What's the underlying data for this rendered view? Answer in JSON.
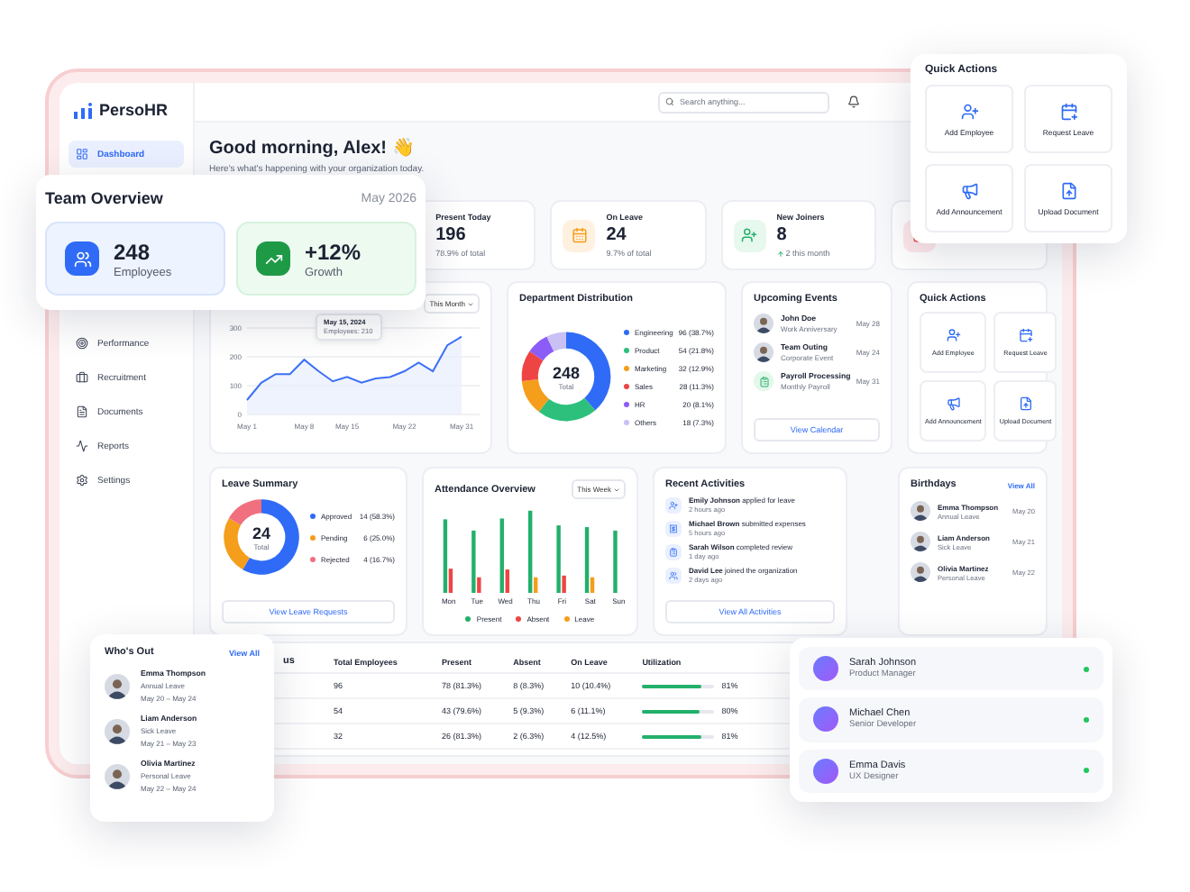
{
  "sidebar": {
    "logo": "PersoHR",
    "items": [
      {
        "label": "Dashboard",
        "selected": true
      },
      {
        "label": "Performance",
        "selected": false
      },
      {
        "label": "Recruitment",
        "selected": false
      },
      {
        "label": "Documents",
        "selected": false
      },
      {
        "label": "Reports",
        "selected": false
      },
      {
        "label": "Settings",
        "selected": false
      }
    ]
  },
  "header": {
    "search": {
      "placeholder": "Search anything..."
    }
  },
  "greeting": {
    "title": "Good morning, Alex! 👋",
    "subtitle": "Here's what's happening with your organization today."
  },
  "stats": [
    {
      "kind": "stat",
      "label": "Present Today",
      "value": "196",
      "note": "78.9% of total",
      "rising": false
    },
    {
      "kind": "stat",
      "label": "On Leave",
      "value": "24",
      "note": "9.7% of total",
      "rising": false
    },
    {
      "kind": "stat",
      "label": "New Joiners",
      "value": "8",
      "note": "2 this month",
      "rising": true
    },
    {
      "kind": "icon_only"
    }
  ],
  "growth": {
    "range": "This Month",
    "tooltip": {
      "date": "May 15, 2024",
      "text": "Employees: 210"
    },
    "chart_data": {
      "type": "area",
      "categories": [
        "May 1",
        null,
        null,
        null,
        "May 8",
        null,
        null,
        "May 15",
        null,
        null,
        null,
        "May 22",
        null,
        null,
        null,
        "May 31"
      ],
      "series": [
        {
          "color": "#3b6ff5",
          "values": [
            50,
            110,
            140,
            140,
            190,
            150,
            115,
            130,
            110,
            125,
            130,
            150,
            180,
            150,
            240,
            270
          ]
        }
      ],
      "ylim": [
        0,
        300
      ],
      "yticks": [
        0,
        100,
        200,
        300
      ]
    }
  },
  "department": {
    "title": "Department Distribution",
    "total": "248",
    "total_label": "Total",
    "legend": [
      {
        "value": "96 (38.7%)",
        "color": "#2f6bf6"
      },
      {
        "value": "54 (21.8%)",
        "color": "#2cc07c"
      },
      {
        "value": "32 (12.9%)",
        "color": "#f59e1b"
      },
      {
        "value": "28 (11.3%)",
        "color": "#ef4444"
      },
      {
        "value": "20 (8.1%)",
        "color": "#8b5cf6"
      },
      {
        "value": "18 (7.3%)",
        "color": "#c9c0f4"
      }
    ],
    "chart_data": {
      "type": "donut",
      "categories": [
        "Engineering",
        "Product",
        "Marketing",
        "Sales",
        "HR",
        "Others"
      ],
      "values": [
        38.7,
        21.8,
        12.9,
        11.3,
        8.1,
        7.2
      ]
    }
  },
  "events": {
    "title": "Upcoming Events",
    "items": [
      {
        "kind": "person",
        "title": "John Doe",
        "subtitle": "Work Anniversary",
        "date": "May 28"
      },
      {
        "kind": "person",
        "title": "Team Outing",
        "subtitle": "Corporate Event",
        "date": "May 24"
      },
      {
        "kind": "task",
        "title": "Payroll Processing",
        "subtitle": "Monthly Payroll",
        "date": "May 31"
      }
    ],
    "button": "View Calendar"
  },
  "quick_actions": {
    "title": "Quick Actions",
    "items": [
      "Add Employee",
      "Request Leave",
      "Add Announcement",
      "Upload Document"
    ]
  },
  "leave": {
    "title": "Leave Summary",
    "total": "24",
    "total_label": "Total",
    "legend": [
      {
        "value": "14 (58.3%)",
        "color": "#2f6bf6"
      },
      {
        "value": "6 (25.0%)",
        "color": "#f59e1b"
      },
      {
        "value": "4 (16.7%)",
        "color": "#f0707f"
      }
    ],
    "chart_data": {
      "type": "donut",
      "categories": [
        "Approved",
        "Pending",
        "Rejected"
      ],
      "values": [
        58.3,
        25.0,
        16.7
      ]
    },
    "button": "View Leave Requests"
  },
  "attendance": {
    "title": "Attendance Overview",
    "range": "This Week",
    "days": [
      "Mon",
      "Tue",
      "Wed",
      "Thu",
      "Fri",
      "Sat",
      "Sun"
    ],
    "legend": [
      {
        "label": "Present",
        "color": "#22b06b"
      },
      {
        "label": "Absent",
        "color": "#ef4444"
      },
      {
        "label": "Leave",
        "color": "#f59e1b"
      }
    ]
  },
  "activities": {
    "title": "Recent Activities",
    "items": [
      {
        "text": "**Emily Johnson** applied for leave",
        "time": "2 hours ago"
      },
      {
        "text": "**Michael Brown** submitted expenses",
        "time": "5 hours ago"
      },
      {
        "text": "**Sarah Wilson** completed review",
        "time": "1 day ago"
      },
      {
        "text": "**David Lee** joined the organization",
        "time": "2 days ago"
      }
    ],
    "button": "View All Activities"
  },
  "birthdays": {
    "title": "Birthdays",
    "link": "View All",
    "items": [
      {
        "name": "Emma Thompson",
        "note": "Annual Leave",
        "date": "May 20"
      },
      {
        "name": "Liam Anderson",
        "note": "Sick Leave",
        "date": "May 21"
      },
      {
        "name": "Olivia Martinez",
        "note": "Personal Leave",
        "date": "May 22"
      }
    ]
  },
  "table": {
    "title_fragment": "us",
    "columns": [
      "Total Employees",
      "Present",
      "Absent",
      "On Leave",
      "Utilization"
    ],
    "rows": [
      {
        "cells": [
          "96",
          "78 (81.3%)",
          "8 (8.3%)",
          "10 (10.4%)"
        ],
        "level": 0.81,
        "reading": "81%"
      },
      {
        "cells": [
          "54",
          "43 (79.6%)",
          "5 (9.3%)",
          "6 (11.1%)"
        ],
        "level": 0.8,
        "reading": "80%"
      },
      {
        "cells": [
          "32",
          "26 (81.3%)",
          "2 (6.3%)",
          "4 (12.5%)"
        ],
        "level": 0.81,
        "reading": "81%"
      }
    ]
  },
  "team_overview": {
    "title": "Team Overview",
    "period": "May 2026",
    "tiles": [
      {
        "kind": "people",
        "value": "248",
        "label": "Employees"
      },
      {
        "kind": "growth",
        "value": "+12%",
        "label": "Growth"
      }
    ]
  },
  "quick_actions_popup": {
    "title": "Quick Actions",
    "items": [
      "Add Employee",
      "Request Leave",
      "Add Announcement",
      "Upload Document"
    ]
  },
  "whos_out": {
    "title": "Who's Out",
    "link": "View All",
    "items": [
      {
        "name": "Emma Thompson",
        "type": "Annual Leave",
        "dates": "May 20 – May 24"
      },
      {
        "name": "Liam Anderson",
        "type": "Sick Leave",
        "dates": "May 21 – May 23"
      },
      {
        "name": "Olivia Martinez",
        "type": "Personal Leave",
        "dates": "May 22 – May 24"
      }
    ]
  },
  "people": [
    {
      "name": "Sarah Johnson",
      "role": "Product Manager",
      "online": true
    },
    {
      "name": "Michael Chen",
      "role": "Senior Developer",
      "online": true
    },
    {
      "name": "Emma Davis",
      "role": "UX Designer",
      "online": true
    }
  ]
}
